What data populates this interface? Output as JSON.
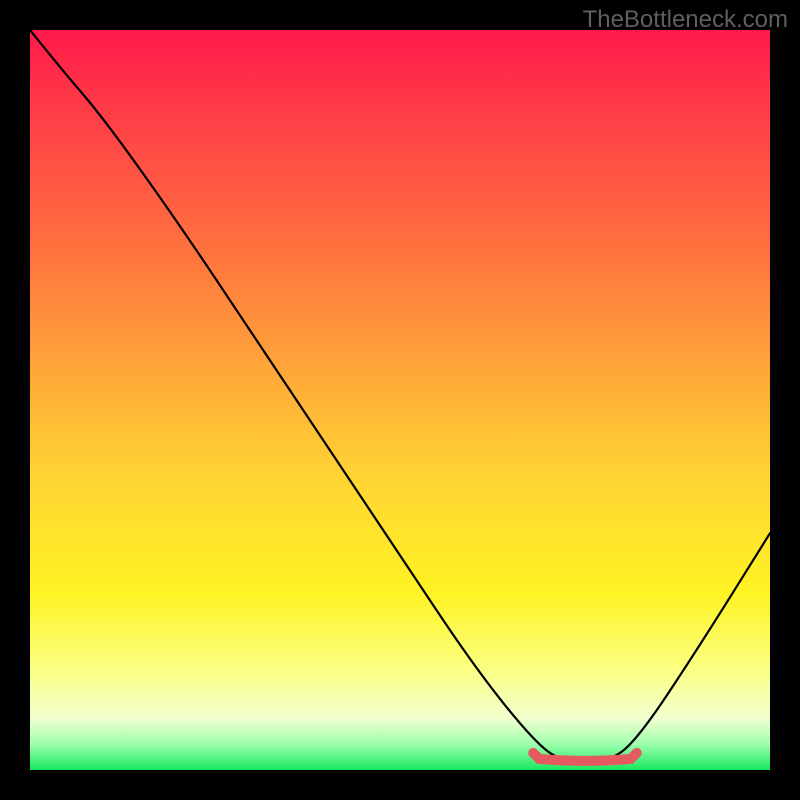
{
  "watermark": "TheBottleneck.com",
  "chart_data": {
    "type": "line",
    "title": "",
    "xlabel": "",
    "ylabel": "",
    "xlim": [
      0,
      100
    ],
    "ylim": [
      0,
      100
    ],
    "grid": false,
    "description": "Bottleneck curve on vertical red→green gradient; valley marks interval of minimal bottleneck.",
    "series": [
      {
        "name": "bottleneck-curve",
        "x": [
          0,
          4,
          10,
          20,
          30,
          40,
          50,
          60,
          68,
          72,
          78,
          82,
          90,
          100
        ],
        "y": [
          100,
          95,
          88,
          74,
          59,
          44,
          29,
          14,
          4,
          1,
          1,
          4,
          16,
          32
        ]
      }
    ],
    "valley_segment": {
      "x_start": 68,
      "x_end": 82,
      "y": 1.5
    },
    "background_gradient_stops": [
      {
        "pos": 0.0,
        "color": "#ff1a4b"
      },
      {
        "pos": 0.12,
        "color": "#ff3f47"
      },
      {
        "pos": 0.28,
        "color": "#ff6d3f"
      },
      {
        "pos": 0.44,
        "color": "#ffa03a"
      },
      {
        "pos": 0.6,
        "color": "#ffd334"
      },
      {
        "pos": 0.76,
        "color": "#fff324"
      },
      {
        "pos": 0.86,
        "color": "#fbff7e"
      },
      {
        "pos": 0.93,
        "color": "#f2ffcf"
      },
      {
        "pos": 0.965,
        "color": "#9effad"
      },
      {
        "pos": 1.0,
        "color": "#17e85e"
      }
    ]
  }
}
